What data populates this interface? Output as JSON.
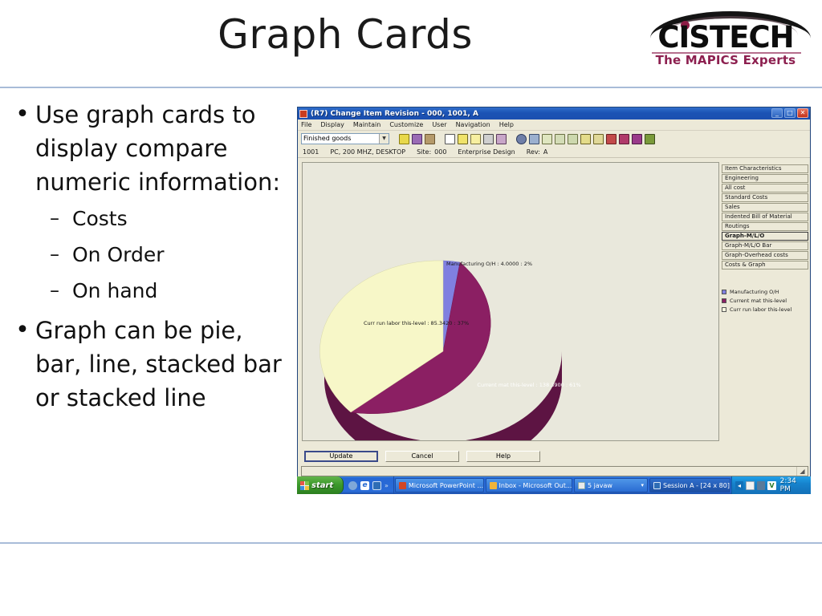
{
  "slide": {
    "title": "Graph Cards",
    "logo": {
      "wordmark": "CISTECH",
      "tagline": "The MAPICS Experts"
    },
    "bullets": [
      {
        "marker": "•",
        "text": "Use graph cards to display compare numeric information:",
        "subitems": [
          {
            "marker": "–",
            "text": "Costs"
          },
          {
            "marker": "–",
            "text": "On Order"
          },
          {
            "marker": "–",
            "text": "On hand"
          }
        ]
      },
      {
        "marker": "•",
        "text": "Graph can be pie, bar, line, stacked bar or stacked line",
        "subitems": []
      }
    ]
  },
  "app": {
    "title": "(R7) Change Item Revision - 000, 1001, A",
    "window_buttons": {
      "minimize": "_",
      "maximize": "□",
      "close": "✕"
    },
    "menu": [
      "File",
      "Display",
      "Maintain",
      "Customize",
      "User",
      "Navigation",
      "Help"
    ],
    "toolbar": {
      "combo_value": "Finished goods",
      "combo_arrow": "▼",
      "icons": [
        "flag-icon",
        "printer-icon",
        "print-preview-icon",
        "new-document-icon",
        "edit-pencil-icon",
        "edit-highlight-icon",
        "key-icon",
        "copy-icon",
        "globe-icon",
        "link-icon",
        "list-view-icon",
        "tree-view-icon",
        "structure-icon",
        "filter-icon",
        "sort-icon",
        "check-flag-icon",
        "flag-yellow-icon",
        "flag-purple-icon",
        "flag-green-icon"
      ]
    },
    "info": {
      "item": "1001",
      "description": "PC, 200 MHZ, DESKTOP",
      "site_label": "Site:",
      "site_value": "000",
      "site_name": "Enterprise Design",
      "rev_label": "Rev:",
      "rev_value": "A"
    },
    "side_buttons": [
      {
        "label": "Item Characteristics",
        "active": false
      },
      {
        "label": "Engineering",
        "active": false
      },
      {
        "label": "All cost",
        "active": false
      },
      {
        "label": "Standard Costs",
        "active": false
      },
      {
        "label": "Sales",
        "active": false
      },
      {
        "label": "Indented Bill of Material",
        "active": false
      },
      {
        "label": "Routings",
        "active": false
      },
      {
        "label": "Graph-M/L/O",
        "active": true
      },
      {
        "label": "Graph-M/L/O Bar",
        "active": false
      },
      {
        "label": "Graph-Overhead costs",
        "active": false
      },
      {
        "label": "Costs & Graph",
        "active": false
      }
    ],
    "dialog_buttons": [
      {
        "label": "Update",
        "default": true
      },
      {
        "label": "Cancel",
        "default": false
      },
      {
        "label": "Help",
        "default": false
      }
    ],
    "statusbar": {
      "text": "",
      "grip": "◢"
    }
  },
  "chart_data": {
    "type": "pie",
    "title": "",
    "legend_position": "right",
    "categories": [
      "Manufacturing O/H",
      "Current mat this-level",
      "Curr run labor this-level"
    ],
    "values": [
      4.0,
      138.39,
      85.342
    ],
    "percents": [
      2,
      61,
      37
    ],
    "colors": [
      "#8080e0",
      "#8b1f63",
      "#f7f7c8"
    ],
    "side_colors": [
      "#5a5ab0",
      "#5d1443",
      "#9a9a6e"
    ],
    "labels": [
      "Manufacturing O/H : 4.0000 : 2%",
      "Current mat this-level : 138.3900 : 61%",
      "Curr run labor this-level : 85.3420 : 37%"
    ],
    "legend": [
      {
        "label": "Manufacturing O/H",
        "color": "#8080e0"
      },
      {
        "label": "Current mat this-level",
        "color": "#8b1f63"
      },
      {
        "label": "Curr run labor this-level",
        "color": "#fbfbe0"
      }
    ]
  },
  "taskbar": {
    "start_label": "start",
    "quicklaunch": [
      "show-desktop-icon",
      "internet-explorer-icon",
      "outlook-icon"
    ],
    "quicklaunch_more": "»",
    "tasks": [
      {
        "label": "Microsoft PowerPoint ...",
        "icon": "powerpoint-icon",
        "selected": false
      },
      {
        "label": "Inbox - Microsoft Out...",
        "icon": "outlook-icon",
        "selected": false
      },
      {
        "label": "5 javaw",
        "icon": "java-window-icon",
        "selected": false,
        "group_arrow": "▾"
      },
      {
        "label": "Session A - [24 x 80]",
        "icon": "terminal-icon",
        "selected": true
      }
    ],
    "tray": [
      "show-hidden-icon",
      "mail-icon",
      "network-icon",
      "volume-icon"
    ],
    "clock": "2:34 PM"
  }
}
